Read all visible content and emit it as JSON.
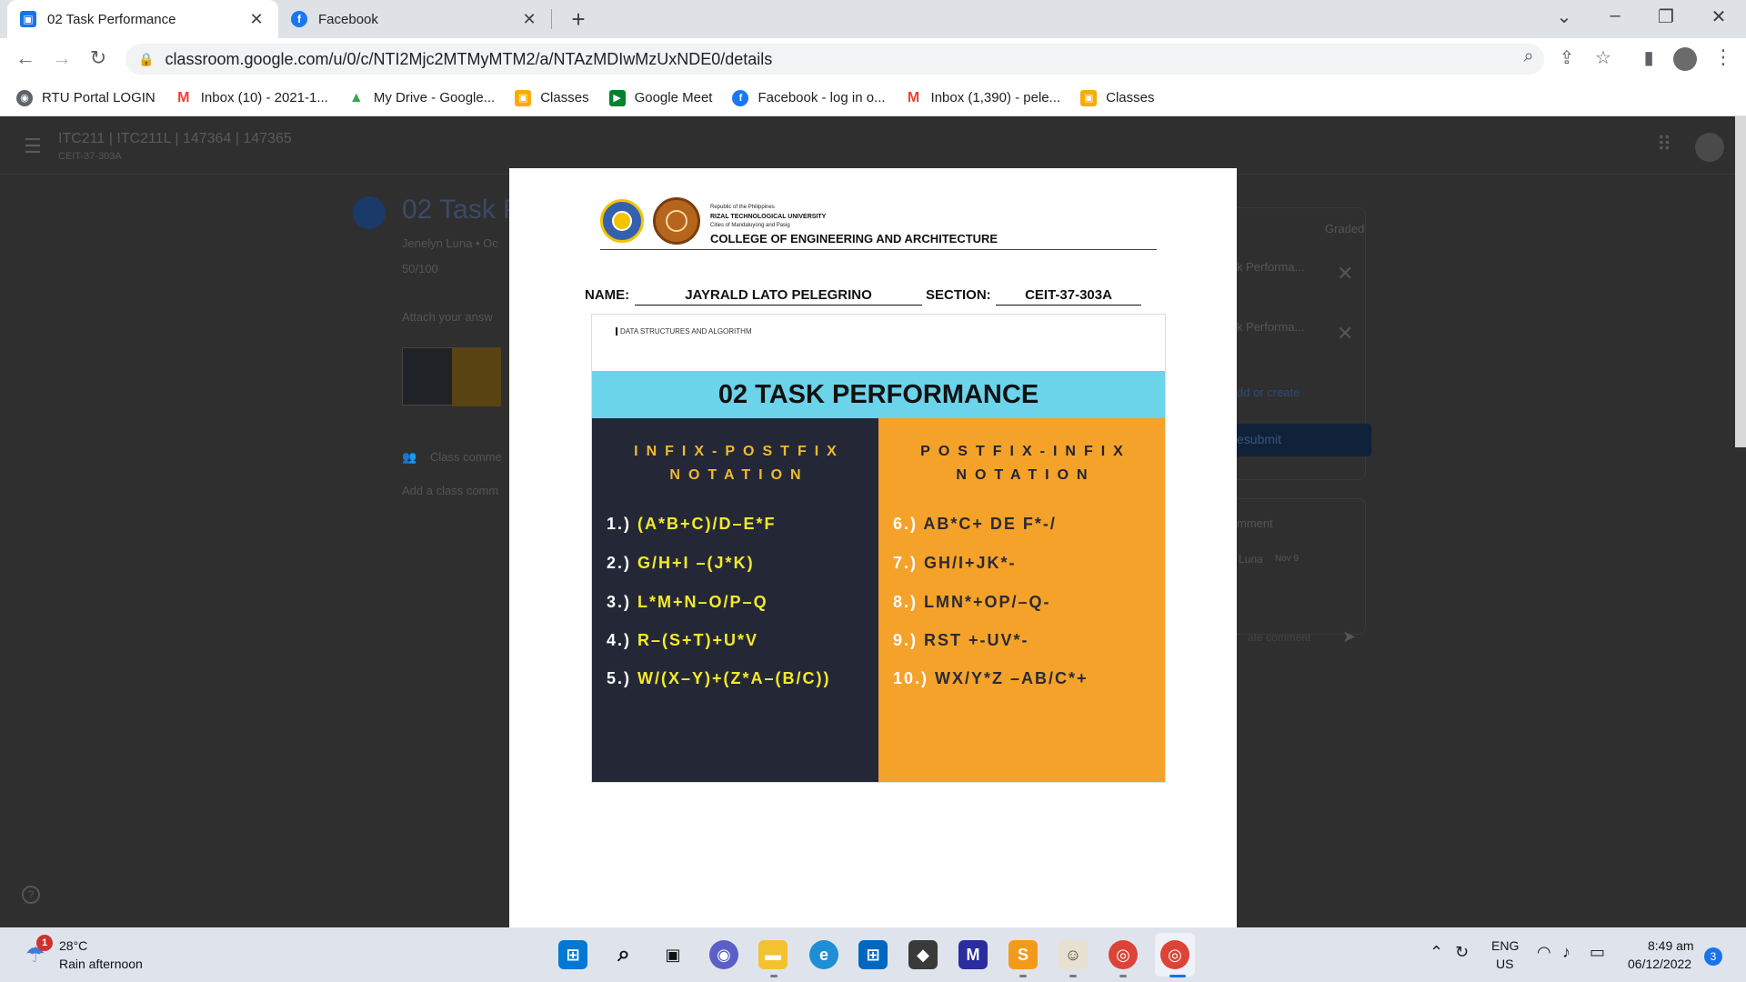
{
  "browser": {
    "tabs": [
      {
        "label": "02 Task Performance",
        "icon": "classroom-icon",
        "active": true
      },
      {
        "label": "Facebook",
        "icon": "facebook-icon",
        "active": false
      }
    ],
    "url": "classroom.google.com/u/0/c/NTI2Mjc2MTMyMTM2/a/NTAzMDIwMzUxNDE0/details",
    "bookmarks": [
      {
        "label": "RTU Portal LOGIN",
        "icon": "globe-icon",
        "color": "#5f6368"
      },
      {
        "label": "Inbox (10) - 2021-1...",
        "icon": "gmail-icon",
        "color": "#ea4335"
      },
      {
        "label": "My Drive - Google...",
        "icon": "drive-icon",
        "color": "#34a853"
      },
      {
        "label": "Classes",
        "icon": "classroom-icon",
        "color": "#f9ab00"
      },
      {
        "label": "Google Meet",
        "icon": "meet-icon",
        "color": "#00832d"
      },
      {
        "label": "Facebook - log in o...",
        "icon": "facebook-icon",
        "color": "#1877f2"
      },
      {
        "label": "Inbox (1,390) - pele...",
        "icon": "gmail-icon",
        "color": "#ea4335"
      },
      {
        "label": "Classes",
        "icon": "classroom-icon",
        "color": "#f9ab00"
      }
    ]
  },
  "classroom": {
    "course_title": "ITC211 | ITC211L | 147364 | 147365",
    "course_section": "CEIT-37-303A",
    "assignment_title": "02 Task P",
    "author": "Jenelyn Luna • Oc",
    "points": "50/100",
    "attach_prompt": "Attach your answ",
    "class_comments": "Class comme",
    "add_class_comment": "Add a class comm",
    "graded": "Graded",
    "file1": "k Performa...",
    "file2": "k Performa...",
    "add_or_create": "dd or create",
    "resubmit": "esubmit",
    "private_comment": "mment",
    "commenter": "Luna",
    "comment_date": "Nov 9",
    "comment_placeholder": "ate comment"
  },
  "document": {
    "letterhead": {
      "republic": "Republic of the Philippines",
      "university": "RIZAL TECHNOLOGICAL UNIVERSITY",
      "cities": "Cities of Mandaluyong and Pasig",
      "college": "COLLEGE OF ENGINEERING AND ARCHITECTURE"
    },
    "name_label": "NAME:",
    "name_value": "JAYRALD LATO PELEGRINO",
    "section_label": "SECTION:",
    "section_value": "CEIT-37-303A",
    "slide": {
      "subtitle": "DATA STRUCTURES AND ALGORITHM",
      "title": "02 TASK PERFORMANCE",
      "left_heading_1": "INFIX-POSTFIX",
      "left_heading_2": "NOTATION",
      "right_heading_1": "POSTFIX-INFIX",
      "right_heading_2": "NOTATION",
      "left_items": [
        {
          "num": "1.)",
          "expr": "(A*B+C)/D–E*F"
        },
        {
          "num": "2.)",
          "expr": "G/H+I –(J*K)"
        },
        {
          "num": "3.)",
          "expr": "L*M+N–O/P–Q"
        },
        {
          "num": "4.)",
          "expr": "R–(S+T)+U*V"
        },
        {
          "num": "5.)",
          "expr": "W/(X–Y)+(Z*A–(B/C))"
        }
      ],
      "right_items": [
        {
          "num": "6.)",
          "expr": "AB*C+ DE F*-/"
        },
        {
          "num": "7.)",
          "expr": "GH/I+JK*-"
        },
        {
          "num": "8.)",
          "expr": "LMN*+OP/–Q-"
        },
        {
          "num": "9.)",
          "expr": "RST +-UV*-"
        },
        {
          "num": "10.)",
          "expr": "WX/Y*Z –AB/C*+"
        }
      ]
    }
  },
  "taskbar": {
    "weather_temp": "28°C",
    "weather_desc": "Rain afternoon",
    "weather_badge": "1",
    "lang_1": "ENG",
    "lang_2": "US",
    "time": "8:49 am",
    "date": "06/12/2022",
    "notifications": "3"
  }
}
